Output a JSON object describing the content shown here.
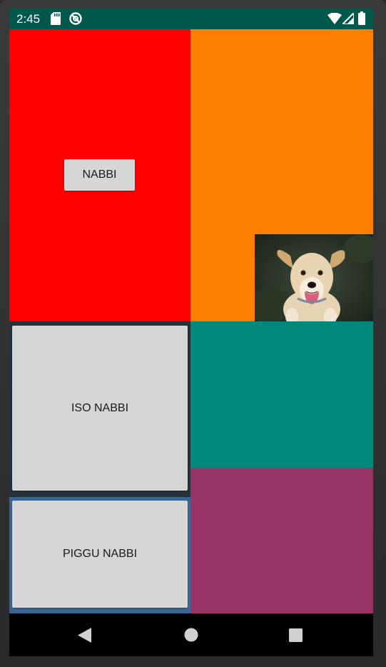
{
  "status_bar": {
    "time": "2:45",
    "icons": [
      "sd-card-icon",
      "sync-disabled-icon",
      "wifi-icon",
      "cellular-signal-icon",
      "battery-icon"
    ],
    "background": "#00574b"
  },
  "tiles": {
    "red_panel_color": "#ff0000",
    "orange_panel_color": "#ff8000",
    "teal_panel_color": "#00897b",
    "plum_panel_color": "#983366",
    "left_column_bg": "#263238"
  },
  "buttons": {
    "nabbi": "NABBI",
    "iso_nabbi": "ISO NABBI",
    "piggu_nabbi": "PIGGU NABBI"
  },
  "image": {
    "subject": "puppy-photo"
  },
  "nav_bar": {
    "icons": [
      "back-icon",
      "home-icon",
      "recents-icon"
    ]
  }
}
